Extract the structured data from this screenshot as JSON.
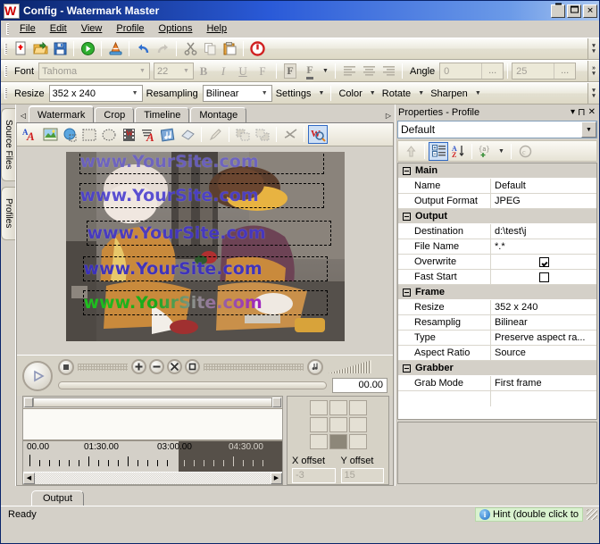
{
  "window": {
    "title": "Config - Watermark Master",
    "logo_text": "W",
    "minimize": "_",
    "maximize": "□",
    "close": "✕"
  },
  "menu": {
    "items": [
      {
        "label": "File"
      },
      {
        "label": "Edit"
      },
      {
        "label": "View"
      },
      {
        "label": "Profile"
      },
      {
        "label": "Options"
      },
      {
        "label": "Help"
      }
    ]
  },
  "main_toolbar": {
    "buttons": [
      {
        "name": "new-icon"
      },
      {
        "name": "open-folder-icon"
      },
      {
        "name": "save-icon"
      },
      {
        "name": "run-icon"
      },
      {
        "name": "convert-icon"
      },
      {
        "name": "undo-icon"
      },
      {
        "name": "redo-icon"
      },
      {
        "name": "cut-icon"
      },
      {
        "name": "copy-icon"
      },
      {
        "name": "paste-icon"
      },
      {
        "name": "stop-icon"
      }
    ],
    "overflow": "»"
  },
  "font_toolbar": {
    "label": "Font",
    "font_name": "Tahoma",
    "font_size": "22",
    "bold": "B",
    "italic": "I",
    "underline": "U",
    "strike": "F",
    "color_f": "F",
    "color_f2": "F",
    "align_left": "align-left",
    "align_center": "align-center",
    "align_right": "align-right",
    "angle_label": "Angle",
    "angle_value": "0",
    "angle_dots": "...",
    "opacity_value": "25",
    "opacity_dots": "..."
  },
  "resize_toolbar": {
    "resize_label": "Resize",
    "resize_value": "352 x 240",
    "resampling_label": "Resampling",
    "resampling_value": "Bilinear",
    "settings_label": "Settings",
    "color_label": "Color",
    "rotate_label": "Rotate",
    "sharpen_label": "Sharpen"
  },
  "side_tabs": {
    "items": [
      {
        "label": "Source Files"
      },
      {
        "label": "Profiles"
      }
    ]
  },
  "editor": {
    "tabs": [
      {
        "label": "Watermark",
        "active": true
      },
      {
        "label": "Crop",
        "active": false
      },
      {
        "label": "Timeline",
        "active": false
      },
      {
        "label": "Montage",
        "active": false
      }
    ],
    "scroll_left": "◁",
    "scroll_right": "▷",
    "tools": [
      {
        "name": "add-text-watermark-icon"
      },
      {
        "name": "add-image-watermark-icon"
      },
      {
        "name": "add-shape-watermark-icon"
      },
      {
        "name": "rectangle-icon"
      },
      {
        "name": "ellipse-icon"
      },
      {
        "name": "video-watermark-icon"
      },
      {
        "name": "text-icon"
      },
      {
        "name": "audio-icon"
      },
      {
        "name": "eraser-icon"
      },
      {
        "name": "pencil-icon"
      },
      {
        "name": "bring-front-icon"
      },
      {
        "name": "send-back-icon"
      },
      {
        "name": "effects-icon"
      },
      {
        "name": "preview-watermark-icon"
      }
    ]
  },
  "preview": {
    "watermark_text": "www.YourSite.com",
    "lines": [
      {
        "text": "www.YourSite.com"
      },
      {
        "text": "www.YourSite.com"
      },
      {
        "text": "www.YourSite.com"
      },
      {
        "text": "www.YourSite.com"
      },
      {
        "text": "www.YourSite.com"
      }
    ]
  },
  "player": {
    "play": "play-icon",
    "stop": "stop-icon",
    "zoom_in": "zoom-in-icon",
    "zoom_out": "zoom-out-icon",
    "fullscreen": "fullscreen-icon",
    "fit": "fit-icon",
    "audio": "audio-icon",
    "time": "00.00"
  },
  "timeline": {
    "labels": [
      "00.00",
      "01:30.00",
      "03:00.00",
      "04:30.00"
    ],
    "left_arrow": "◀",
    "right_arrow": "▶"
  },
  "offsets": {
    "x_label": "X offset",
    "x_value": "-3",
    "y_label": "Y offset",
    "y_value": "15",
    "anchor_selected_index": 7
  },
  "properties": {
    "title": "Properties - Profile",
    "menu_btn": "▾",
    "pin_btn": "⊐",
    "close_btn": "✕",
    "profile_value": "Default",
    "toolbar": [
      {
        "name": "up-level-icon"
      },
      {
        "name": "categorized-icon"
      },
      {
        "name": "alphabetical-sort-icon"
      },
      {
        "name": "new-property-icon"
      },
      {
        "name": "about-icon"
      }
    ],
    "groups": [
      {
        "name": "Main",
        "rows": [
          {
            "key": "Name",
            "value": "Default",
            "type": "text"
          },
          {
            "key": "Output Format",
            "value": "JPEG",
            "type": "text"
          }
        ]
      },
      {
        "name": "Output",
        "rows": [
          {
            "key": "Destination",
            "value": "d:\\test\\j",
            "type": "text"
          },
          {
            "key": "File Name",
            "value": "*.*",
            "type": "text"
          },
          {
            "key": "Overwrite",
            "value": "",
            "type": "checkbox",
            "checked": true
          },
          {
            "key": "Fast Start",
            "value": "",
            "type": "checkbox",
            "checked": false
          }
        ]
      },
      {
        "name": "Frame",
        "rows": [
          {
            "key": "Resize",
            "value": "352 x 240",
            "type": "text"
          },
          {
            "key": "Resamplig",
            "value": "Bilinear",
            "type": "text"
          },
          {
            "key": "Type",
            "value": "Preserve aspect ra...",
            "type": "text"
          },
          {
            "key": "Aspect Ratio",
            "value": "Source",
            "type": "text"
          }
        ]
      },
      {
        "name": "Grabber",
        "rows": [
          {
            "key": "Grab Mode",
            "value": "First frame",
            "type": "text"
          }
        ]
      }
    ]
  },
  "bottom": {
    "tab_label": "Output"
  },
  "status": {
    "message": "Ready",
    "hint": "Hint (double click to"
  },
  "colors": {
    "title_start": "#0a246a",
    "face": "#d4d0c8",
    "toolbar": "#ece9d8",
    "hint_bg": "#d9f2cf",
    "watermark_blue": "#4a3fd0"
  }
}
